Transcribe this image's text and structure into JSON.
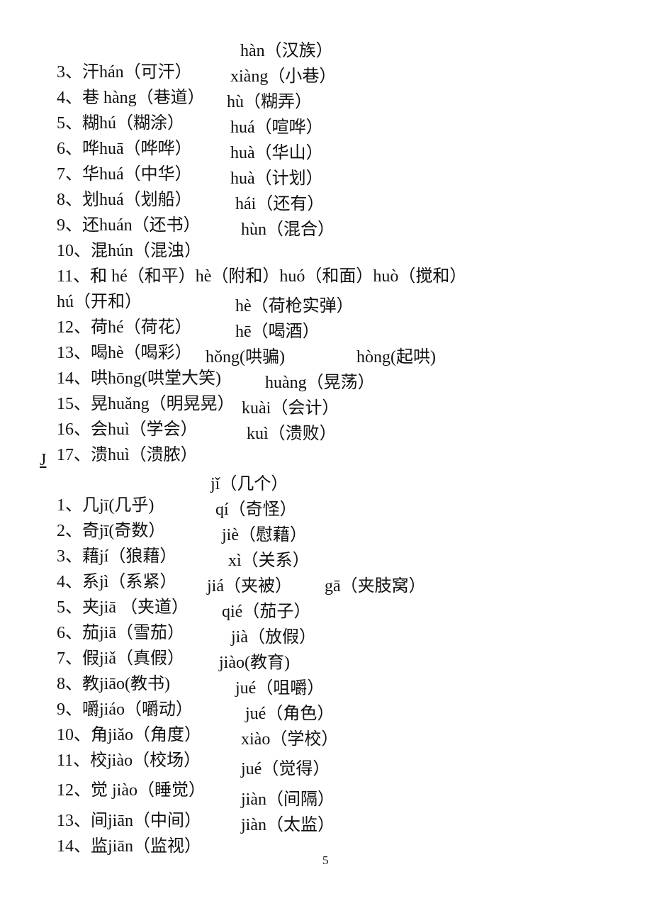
{
  "page_number": "5",
  "section_h": {
    "items": [
      {
        "num": "3、",
        "char": "汗",
        "reading1": "hán（可汗）",
        "reading2": "hàn（汉族）"
      },
      {
        "num": "4、",
        "char": "巷 ",
        "reading1": "hàng（巷道）",
        "reading2": "xiàng（小巷）"
      },
      {
        "num": "5、",
        "char": "糊",
        "reading1": "hú（糊涂）",
        "reading2": "hù（糊弄）"
      },
      {
        "num": "6、",
        "char": "哗",
        "reading1": "huā（哗哗）",
        "reading2": "huá（喧哗）"
      },
      {
        "num": "7、",
        "char": "华",
        "reading1": "huá（中华）",
        "reading2": "huà（华山）"
      },
      {
        "num": "8、",
        "char": "划",
        "reading1": "huá（划船）",
        "reading2": "huà（计划）"
      },
      {
        "num": "9、",
        "char": "还",
        "reading1": "huán（还书）",
        "reading2": "hái（还有）"
      },
      {
        "num": "10、",
        "char": "混",
        "reading1": "hún（混浊）",
        "reading2": "hùn（混合）"
      },
      {
        "num": "11、",
        "char": "和 ",
        "reading1": "hé（和平）hè（附和）huó（和面）huò（搅和）",
        "reading2": ""
      },
      {
        "num": "",
        "char": "",
        "reading1": "hú（开和）",
        "reading2": ""
      },
      {
        "num": "12、",
        "char": "荷",
        "reading1": "hé（荷花）",
        "reading2": "hè（荷枪实弹）"
      },
      {
        "num": "13、",
        "char": "喝",
        "reading1": "hè（喝彩）",
        "reading2": "hē（喝酒）"
      },
      {
        "num": "14、",
        "char": "哄",
        "reading1": "hōng(哄堂大笑)",
        "reading2": "hǒng(哄骗)",
        "reading3": "hòng(起哄)"
      },
      {
        "num": "15、",
        "char": "晃",
        "reading1": "huǎng（明晃晃）",
        "reading2": "huàng（晃荡）"
      },
      {
        "num": "16、",
        "char": "会",
        "reading1": "huì（学会）",
        "reading2": "kuài（会计）"
      },
      {
        "num": "17、",
        "char": "溃",
        "reading1": "huì（溃脓）",
        "reading2": "kuì（溃败）"
      }
    ]
  },
  "section_j": {
    "header": "J",
    "items": [
      {
        "num": "1、",
        "char": "几",
        "reading1": "jī(几乎)",
        "reading2": "jǐ（几个）"
      },
      {
        "num": "2、",
        "char": "奇",
        "reading1": "jī(奇数）",
        "reading2": "qí（奇怪）"
      },
      {
        "num": "3、",
        "char": "藉",
        "reading1": "jí（狼藉）",
        "reading2": "jiè（慰藉）"
      },
      {
        "num": "4、",
        "char": "系",
        "reading1": "jì（系紧）",
        "reading2": "xì（关系）"
      },
      {
        "num": "5、",
        "char": "夹",
        "reading1": "jiā （夹道）",
        "reading2": "jiá（夹被）",
        "reading3": "gā（夹肢窝）"
      },
      {
        "num": "6、",
        "char": "茄",
        "reading1": "jiā（雪茄）",
        "reading2": "qié（茄子）"
      },
      {
        "num": "7、",
        "char": "假",
        "reading1": "jiǎ（真假）",
        "reading2": "jià（放假）"
      },
      {
        "num": "8、",
        "char": "教",
        "reading1": "jiāo(教书)",
        "reading2": "jiào(教育)"
      },
      {
        "num": "9、",
        "char": "嚼",
        "reading1": "jiáo（嚼动）",
        "reading2": "jué（咀嚼）"
      },
      {
        "num": "10、",
        "char": "角",
        "reading1": "jiǎo（角度）",
        "reading2": "jué（角色）"
      },
      {
        "num": "11、",
        "char": "校",
        "reading1": "jiào（校场）",
        "reading2": "xiào（学校）"
      },
      {
        "num": "12、",
        "char": "觉 ",
        "reading1": "jiào（睡觉）",
        "reading2": "jué（觉得）"
      },
      {
        "num": "13、",
        "char": "间",
        "reading1": "jiān（中间）",
        "reading2": "jiàn（间隔）"
      },
      {
        "num": "14、",
        "char": "监",
        "reading1": "jiān（监视）",
        "reading2": "jiàn（太监）"
      }
    ]
  }
}
